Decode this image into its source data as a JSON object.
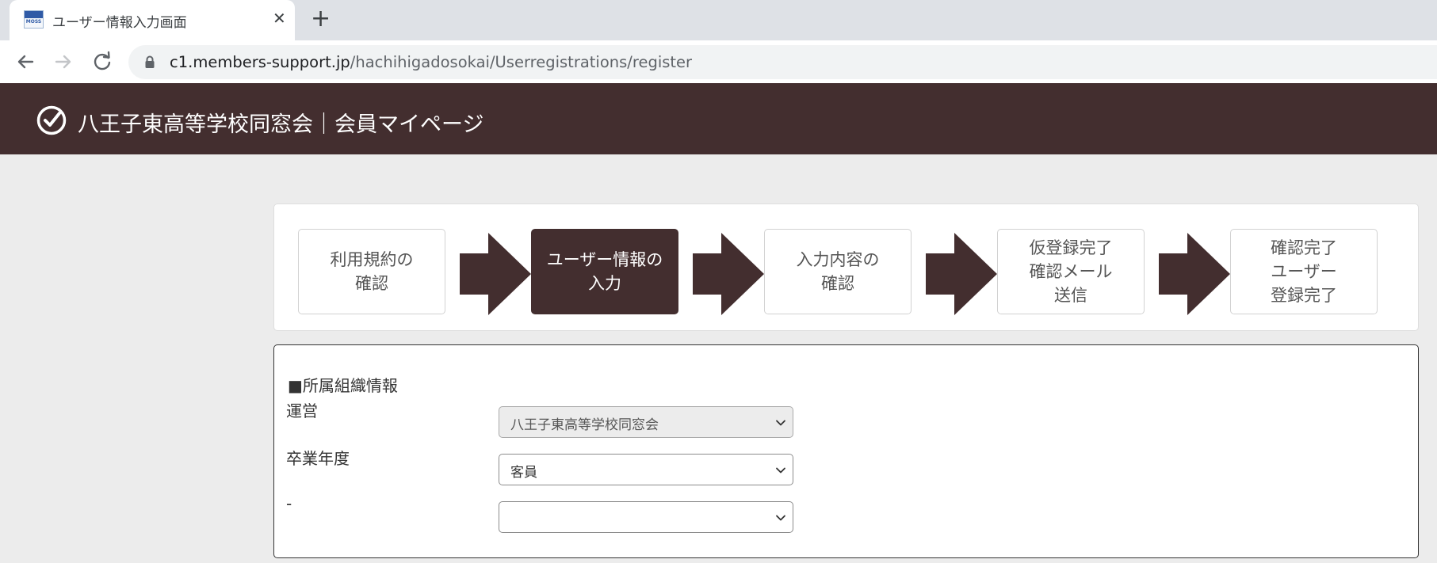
{
  "browser": {
    "tab_title": "ユーザー情報入力画面",
    "favicon_text": "MOSS",
    "close_label": "✕",
    "newtab_label": "+",
    "url_host": "c1.members-support.jp",
    "url_path": "/hachihigadosokai/Userregistrations/register"
  },
  "site": {
    "title": "八王子東高等学校同窓会｜会員マイページ"
  },
  "steps": [
    {
      "label": "利用規約の\n確認",
      "active": false
    },
    {
      "label": "ユーザー情報の\n入力",
      "active": true
    },
    {
      "label": "入力内容の\n確認",
      "active": false
    },
    {
      "label": "仮登録完了\n確認メール\n送信",
      "active": false
    },
    {
      "label": "確認完了\nユーザー\n登録完了",
      "active": false
    }
  ],
  "form": {
    "section_title": "■所属組織情報",
    "fields": [
      {
        "label": "運営",
        "value": "八王子東高等学校同窓会",
        "disabled": true
      },
      {
        "label": "卒業年度",
        "value": "客員",
        "disabled": false
      },
      {
        "label": "-",
        "value": "",
        "disabled": false
      }
    ]
  },
  "colors": {
    "brand": "#432e2f",
    "page_bg": "#ececec"
  },
  "icons": {
    "back": "arrow-left-icon",
    "forward": "arrow-right-icon",
    "reload": "reload-icon",
    "lock": "lock-icon",
    "logo": "check-circle-icon",
    "select": "chevron-down-icon"
  }
}
